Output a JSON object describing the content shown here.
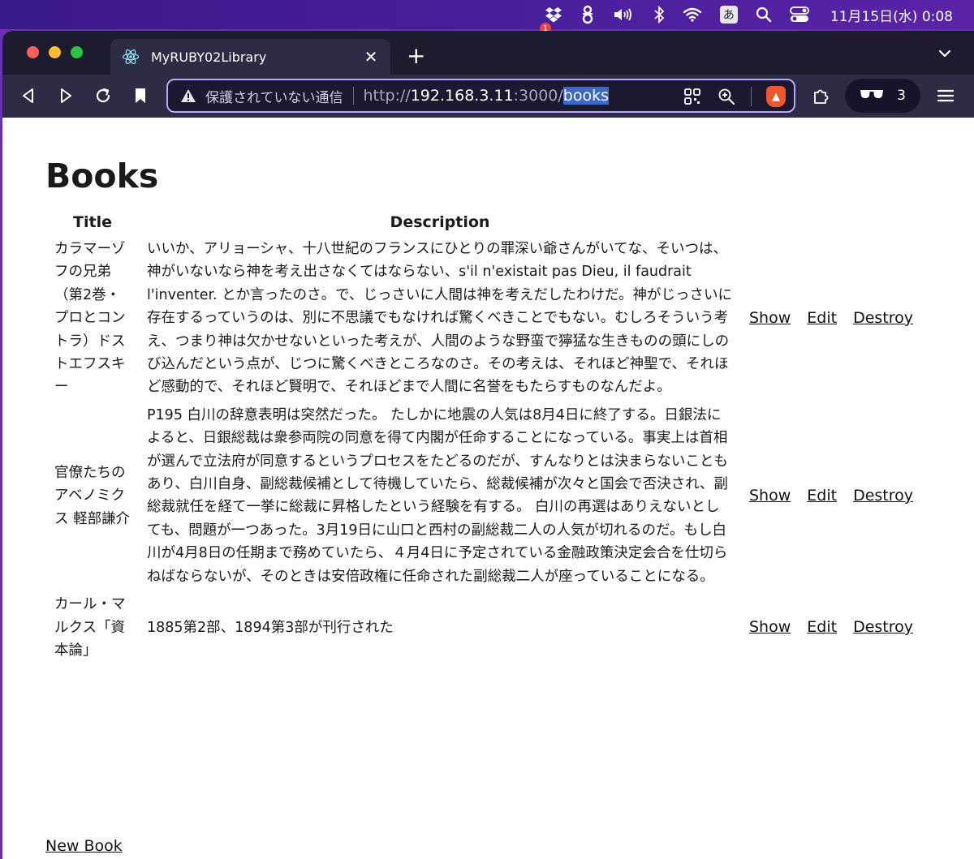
{
  "menubar": {
    "badge_count": "1",
    "ime_label": "あ",
    "clock": "11月15日(水) 0:08"
  },
  "browser": {
    "tab_title": "MyRUBY02Library",
    "new_tab": "+",
    "url_insecure_label": "保護されていない通信",
    "url_scheme": "http://",
    "url_host": "192.168.3.11",
    "url_port": ":3000/",
    "url_path": "books",
    "shields_count": "3"
  },
  "page": {
    "title": "Books",
    "columns": {
      "title": "Title",
      "description": "Description"
    },
    "rows": [
      {
        "title": "カラマーゾフの兄弟（第2巻・プロとコントラ）ドストエフスキー",
        "description": "いいか、アリョーシャ、十八世紀のフランスにひとりの罪深い爺さんがいてな、そいつは、神がいないなら神を考え出さなくてはならない、s'il n'existait pas Dieu, il faudrait l'inventer. とか言ったのさ。で、じっさいに人間は神を考えだしたわけだ。神がじっさいに存在するっていうのは、別に不思議でもなければ驚くべきことでもない。むしろそういう考え、つまり神は欠かせないといった考えが、人間のような野蛮で獰猛な生きものの頭にしのび込んだという点が、じつに驚くべきところなのさ。その考えは、それほど神聖で、それほど感動的で、それほど賢明で、それほどまで人間に名誉をもたらすものなんだよ。",
        "show": "Show",
        "edit": "Edit",
        "destroy": "Destroy"
      },
      {
        "title": "官僚たちのアベノミクス 軽部謙介",
        "description": "P195 白川の辞意表明は突然だった。 たしかに地震の人気は8月4日に終了する。日銀法によると、日銀総裁は衆参両院の同意を得て内閣が任命することになっている。事実上は首相が選んで立法府が同意するというプロセスをたどるのだが、すんなりとは決まらないこともあり、白川自身、副総裁候補として待機していたら、総裁候補が次々と国会で否決され、副総裁就任を経て一挙に総裁に昇格したという経験を有する。 白川の再選はありえないとしても、問題が一つあった。3月19日に山口と西村の副総裁二人の人気が切れるのだ。もし白川が4月8日の任期まで務めていたら、４月4日に予定されている金融政策決定会合を仕切らねばならないが、そのときは安倍政権に任命された副総裁二人が座っていることになる。",
        "show": "Show",
        "edit": "Edit",
        "destroy": "Destroy"
      },
      {
        "title": "カール・マルクス「資本論」",
        "description": "1885第2部、1894第3部が刊行された",
        "show": "Show",
        "edit": "Edit",
        "destroy": "Destroy"
      }
    ],
    "new_book": "New Book"
  }
}
